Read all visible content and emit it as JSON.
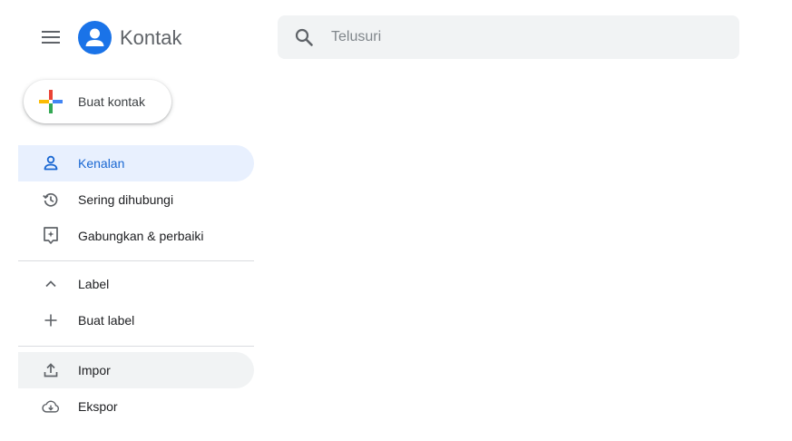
{
  "header": {
    "app_title": "Kontak",
    "menu_icon": "hamburger-menu-icon",
    "logo_icon": "contacts-logo-icon"
  },
  "search": {
    "placeholder": "Telusuri",
    "value": "",
    "icon": "search-icon"
  },
  "create_button": {
    "label": "Buat kontak",
    "icon": "multicolor-plus-icon"
  },
  "nav": {
    "items": [
      {
        "label": "Kenalan",
        "icon": "person-icon",
        "state": "active"
      },
      {
        "label": "Sering dihubungi",
        "icon": "history-icon",
        "state": "normal"
      },
      {
        "label": "Gabungkan & perbaiki",
        "icon": "merge-fix-icon",
        "state": "normal"
      }
    ],
    "labels_section": {
      "header": "Label",
      "header_icon": "chevron-up-icon",
      "create_label": "Buat label",
      "create_icon": "plus-icon"
    },
    "bottom_items": [
      {
        "label": "Impor",
        "icon": "upload-icon",
        "state": "hover"
      },
      {
        "label": "Ekspor",
        "icon": "cloud-download-icon",
        "state": "normal"
      }
    ]
  },
  "colors": {
    "accent": "#1a73e8",
    "active_bg": "#e8f0fe",
    "active_text": "#1967d2",
    "hover_bg": "#f1f3f4",
    "icon_gray": "#5f6368",
    "plus_red": "#ea4335",
    "plus_blue": "#4285f4",
    "plus_yellow": "#fbbc04",
    "plus_green": "#34a853"
  }
}
